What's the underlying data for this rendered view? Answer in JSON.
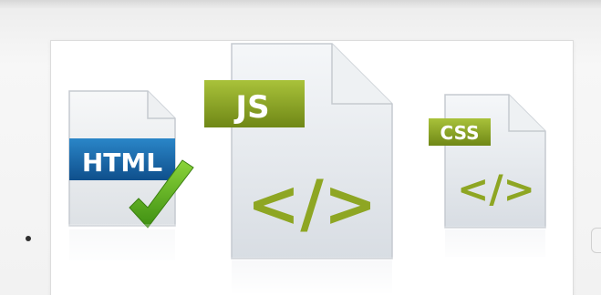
{
  "icons": [
    {
      "label": "HTML",
      "icon": "html-document-icon",
      "overlay": "green-checkmark-icon",
      "label_bg": "#1b6bab"
    },
    {
      "label": "JS",
      "icon": "js-document-icon",
      "symbol": "</>",
      "label_bg": "#8ea623"
    },
    {
      "label": "CSS",
      "icon": "css-document-icon",
      "symbol": "</>",
      "label_bg": "#8ea623"
    }
  ],
  "colors": {
    "accent_green": "#8ea623",
    "html_blue": "#1b6bab",
    "check_green": "#5faa1e"
  }
}
